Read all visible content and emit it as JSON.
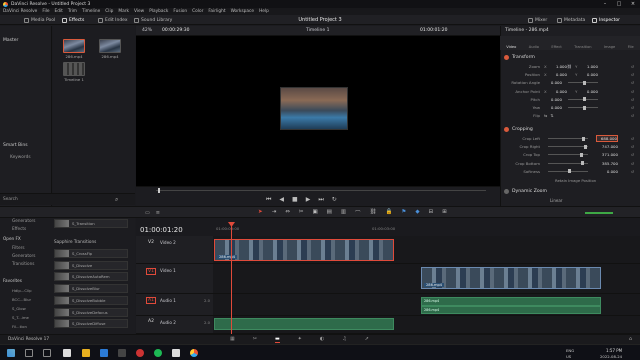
{
  "window": {
    "title": "DaVinci Resolve - Untitled Project 3"
  },
  "menu": [
    "DaVinci Resolve",
    "File",
    "Edit",
    "Trim",
    "Timeline",
    "Clip",
    "Mark",
    "View",
    "Playback",
    "Fusion",
    "Color",
    "Fairlight",
    "Workspace",
    "Help"
  ],
  "toolbar": {
    "media_pool": "Media Pool",
    "effects": "Effects",
    "edit_index": "Edit Index",
    "sound_library": "Sound Library",
    "project_title": "Untitled Project 3",
    "mixer": "Mixer",
    "metadata": "Metadata",
    "inspector": "Inspector"
  },
  "left": {
    "master": "Master",
    "smart_bins": "Smart Bins",
    "keywords": "Keywords",
    "search_placeholder": "Search"
  },
  "media_pool": {
    "clips": [
      {
        "name": "286.mp4"
      },
      {
        "name": "286.mp4"
      },
      {
        "name": "Timeline 1"
      }
    ]
  },
  "viewer": {
    "zoom": "42%",
    "source_tc": "00:00:29:30",
    "timeline_name": "Timeline 1",
    "record_tc": "01:00:01:20"
  },
  "inspector": {
    "header": "Timeline - 286.mp4",
    "tabs": [
      "Video",
      "Audio",
      "Effect",
      "Transition",
      "Image",
      "File"
    ],
    "transform": {
      "title": "Transform",
      "rows": [
        {
          "label": "Zoom",
          "x_tag": "X",
          "x": "1.000",
          "y_tag": "Y",
          "y": "1.000"
        },
        {
          "label": "Position",
          "x_tag": "X",
          "x": "0.000",
          "y_tag": "Y",
          "y": "0.000"
        },
        {
          "label": "Rotation Angle",
          "x": "0.000"
        },
        {
          "label": "Anchor Point",
          "x_tag": "X",
          "x": "0.000",
          "y_tag": "Y",
          "y": "0.000"
        },
        {
          "label": "Pitch",
          "x": "0.000"
        },
        {
          "label": "Yaw",
          "x": "0.000"
        },
        {
          "label": "Flip"
        }
      ]
    },
    "cropping": {
      "title": "Cropping",
      "rows": [
        {
          "label": "Crop Left",
          "value": "688.000",
          "slider": 0.85
        },
        {
          "label": "Crop Right",
          "value": "747.000",
          "slider": 0.9
        },
        {
          "label": "Crop Top",
          "value": "371.000",
          "slider": 0.8
        },
        {
          "label": "Crop Bottom",
          "value": "385.700",
          "slider": 0.82
        },
        {
          "label": "Softness",
          "value": "0.000",
          "slider": 0.5
        }
      ],
      "retain": "Retain Image Position"
    },
    "dynamic_zoom": "Dynamic Zoom",
    "linear": "Linear"
  },
  "timeline": {
    "timecode": "01:00:01:20",
    "ruler": [
      "01:00:00:00",
      "01:00:03:00"
    ],
    "tracks": [
      {
        "label": "V2",
        "name": "Video 2"
      },
      {
        "label": "V1",
        "name": "Video 1"
      },
      {
        "label": "A1",
        "name": "Audio 1",
        "level": "2.0"
      },
      {
        "label": "A2",
        "name": "Audio 2",
        "level": "2.0"
      }
    ],
    "clip_name": "286.mp4"
  },
  "effects": {
    "toolbox": [
      "Titles",
      "Generators",
      "Effects"
    ],
    "open_fx": "Open FX",
    "open_fx_items": [
      "Filters",
      "Generators",
      "Transitions"
    ],
    "favorites": "Favorites",
    "favorite_items": [
      "Hdlp...Clip",
      "BCC...Blur",
      "S_Glow",
      "S_T...ime",
      "Fil...tion"
    ],
    "builder_title": "Sapphire Builder",
    "builder_item": "S_Transition",
    "transitions_title": "Sapphire Transitions",
    "transition_items": [
      "S_CrossFip",
      "S_Dissolve",
      "S_DissolveAutoRem",
      "S_DissolveBlur",
      "S_DissolveBubble",
      "S_DissolveDefocus",
      "S_DissolveDiffuse"
    ]
  },
  "pagebar": {
    "app": "DaVinci Resolve 17"
  },
  "taskbar": {
    "lang": "ENG",
    "region": "US",
    "time": "1:57 PM",
    "date": "2022-08-24"
  }
}
